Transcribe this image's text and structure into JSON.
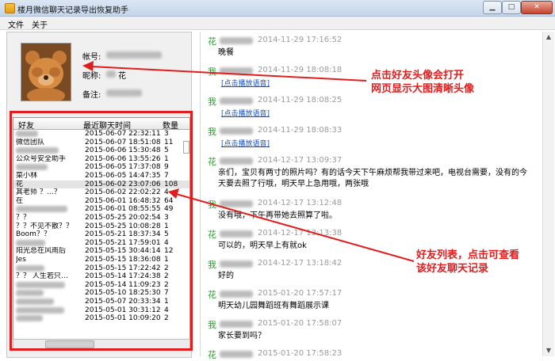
{
  "window": {
    "title": "楼月微信聊天记录导出恢复助手",
    "min_label": "▁",
    "max_label": "□",
    "close_label": "✕"
  },
  "menu": [
    "文件",
    "关于"
  ],
  "profile": {
    "account_label": "帐号:",
    "nickname_label": "昵称:",
    "nickname_value": "花",
    "remark_label": "备注:"
  },
  "friend_table": {
    "headers": [
      "好友",
      "最近聊天时间",
      "数量"
    ],
    "rows": [
      {
        "name": "",
        "time": "2015-06-07 22:32:11",
        "count": "3"
      },
      {
        "name": "微信团队",
        "time": "2015-06-07 18:51:08",
        "count": "11"
      },
      {
        "name": "",
        "time": "2015-06-06 15:30:48",
        "count": "5"
      },
      {
        "name": "公众号安全助手",
        "time": "2015-06-06 13:55:26",
        "count": "1"
      },
      {
        "name": "",
        "time": "2015-06-05 17:37:08",
        "count": "9"
      },
      {
        "name": "菜小林",
        "time": "2015-06-05 14:47:35",
        "count": "7"
      },
      {
        "name": "花",
        "time": "2015-06-02 23:07:06",
        "count": "108"
      },
      {
        "name": "其老师 ？…？",
        "time": "2015-06-02 22:02:22",
        "count": "4"
      },
      {
        "name": "在",
        "time": "2015-06-01 16:48:32",
        "count": "64"
      },
      {
        "name": "",
        "time": "2015-06-01 08:55:55",
        "count": "49"
      },
      {
        "name": "？？",
        "time": "2015-05-25 20:02:54",
        "count": "3"
      },
      {
        "name": "？？不见不散？？",
        "time": "2015-05-25 10:08:28",
        "count": "1"
      },
      {
        "name": "Boom？？",
        "time": "2015-05-21 18:37:34",
        "count": "5"
      },
      {
        "name": "",
        "time": "2015-05-21 17:59:01",
        "count": "4"
      },
      {
        "name": "阳光总在风雨后",
        "time": "2015-05-15 30:44:14",
        "count": "12"
      },
      {
        "name": "Jes",
        "time": "2015-05-15 18:36:08",
        "count": "1"
      },
      {
        "name": "",
        "time": "2015-05-15 17:22:42",
        "count": "2"
      },
      {
        "name": "？？    人生若只…",
        "time": "2015-05-14 17:24:38",
        "count": "2"
      },
      {
        "name": "",
        "time": "2015-05-14 11:09:23",
        "count": "2"
      },
      {
        "name": "",
        "time": "2015-05-10 18:25:30",
        "count": "7"
      },
      {
        "name": "",
        "time": "2015-05-07 20:33:34",
        "count": "1"
      },
      {
        "name": "",
        "time": "2015-05-01 30:31:12",
        "count": "4"
      },
      {
        "name": "",
        "time": "2015-05-01 10:09:20",
        "count": "2"
      }
    ]
  },
  "chat": [
    {
      "sender": "花",
      "time": "2014-11-29 17:16:52",
      "text": "晚餐",
      "type": "text"
    },
    {
      "sender": "我",
      "time": "2014-11-29 18:08:18",
      "text": "[点击播放语音]",
      "type": "voice"
    },
    {
      "sender": "我",
      "time": "2014-11-29 18:08:25",
      "text": "[点击播放语音]",
      "type": "voice"
    },
    {
      "sender": "我",
      "time": "2014-11-29 18:08:33",
      "text": "[点击播放语音]",
      "type": "voice"
    },
    {
      "sender": "花",
      "time": "2014-12-17 13:09:37",
      "text": "亲们，宝贝有两寸的照片吗？有的话今天下午麻烦帮我带过来吧，电视台需要，没有的今天要去照了行哦，明天早上急用哦，两张哦",
      "type": "text"
    },
    {
      "sender": "我",
      "time": "2014-12-17 13:12:48",
      "text": "没有哦，下午再带她去照算了啦。",
      "type": "text"
    },
    {
      "sender": "花",
      "time": "2014-12-17 13:13:38",
      "text": "可以的，明天早上有就ok",
      "type": "text"
    },
    {
      "sender": "我",
      "time": "2014-12-17 13:18:42",
      "text": "好的",
      "type": "text"
    },
    {
      "sender": "花",
      "time": "2015-01-20 17:57:17",
      "text": "明天幼儿园舞蹈班有舞蹈展示课",
      "type": "text"
    },
    {
      "sender": "我",
      "time": "2015-01-20 17:58:07",
      "text": "家长要到吗？",
      "type": "text"
    },
    {
      "sender": "花",
      "time": "2015-01-20 17:58:23",
      "text": "",
      "type": "text"
    }
  ],
  "annotations": {
    "avatar_note": [
      "点击好友头像会打开",
      "网页显示大图清晰头像"
    ],
    "list_note": [
      "好友列表，点击可查看",
      "该好友聊天记录"
    ]
  },
  "colors": {
    "annotation_red": "#e21d1d",
    "sender_green": "#2a9a2a",
    "link_blue": "#1a4fc0"
  }
}
